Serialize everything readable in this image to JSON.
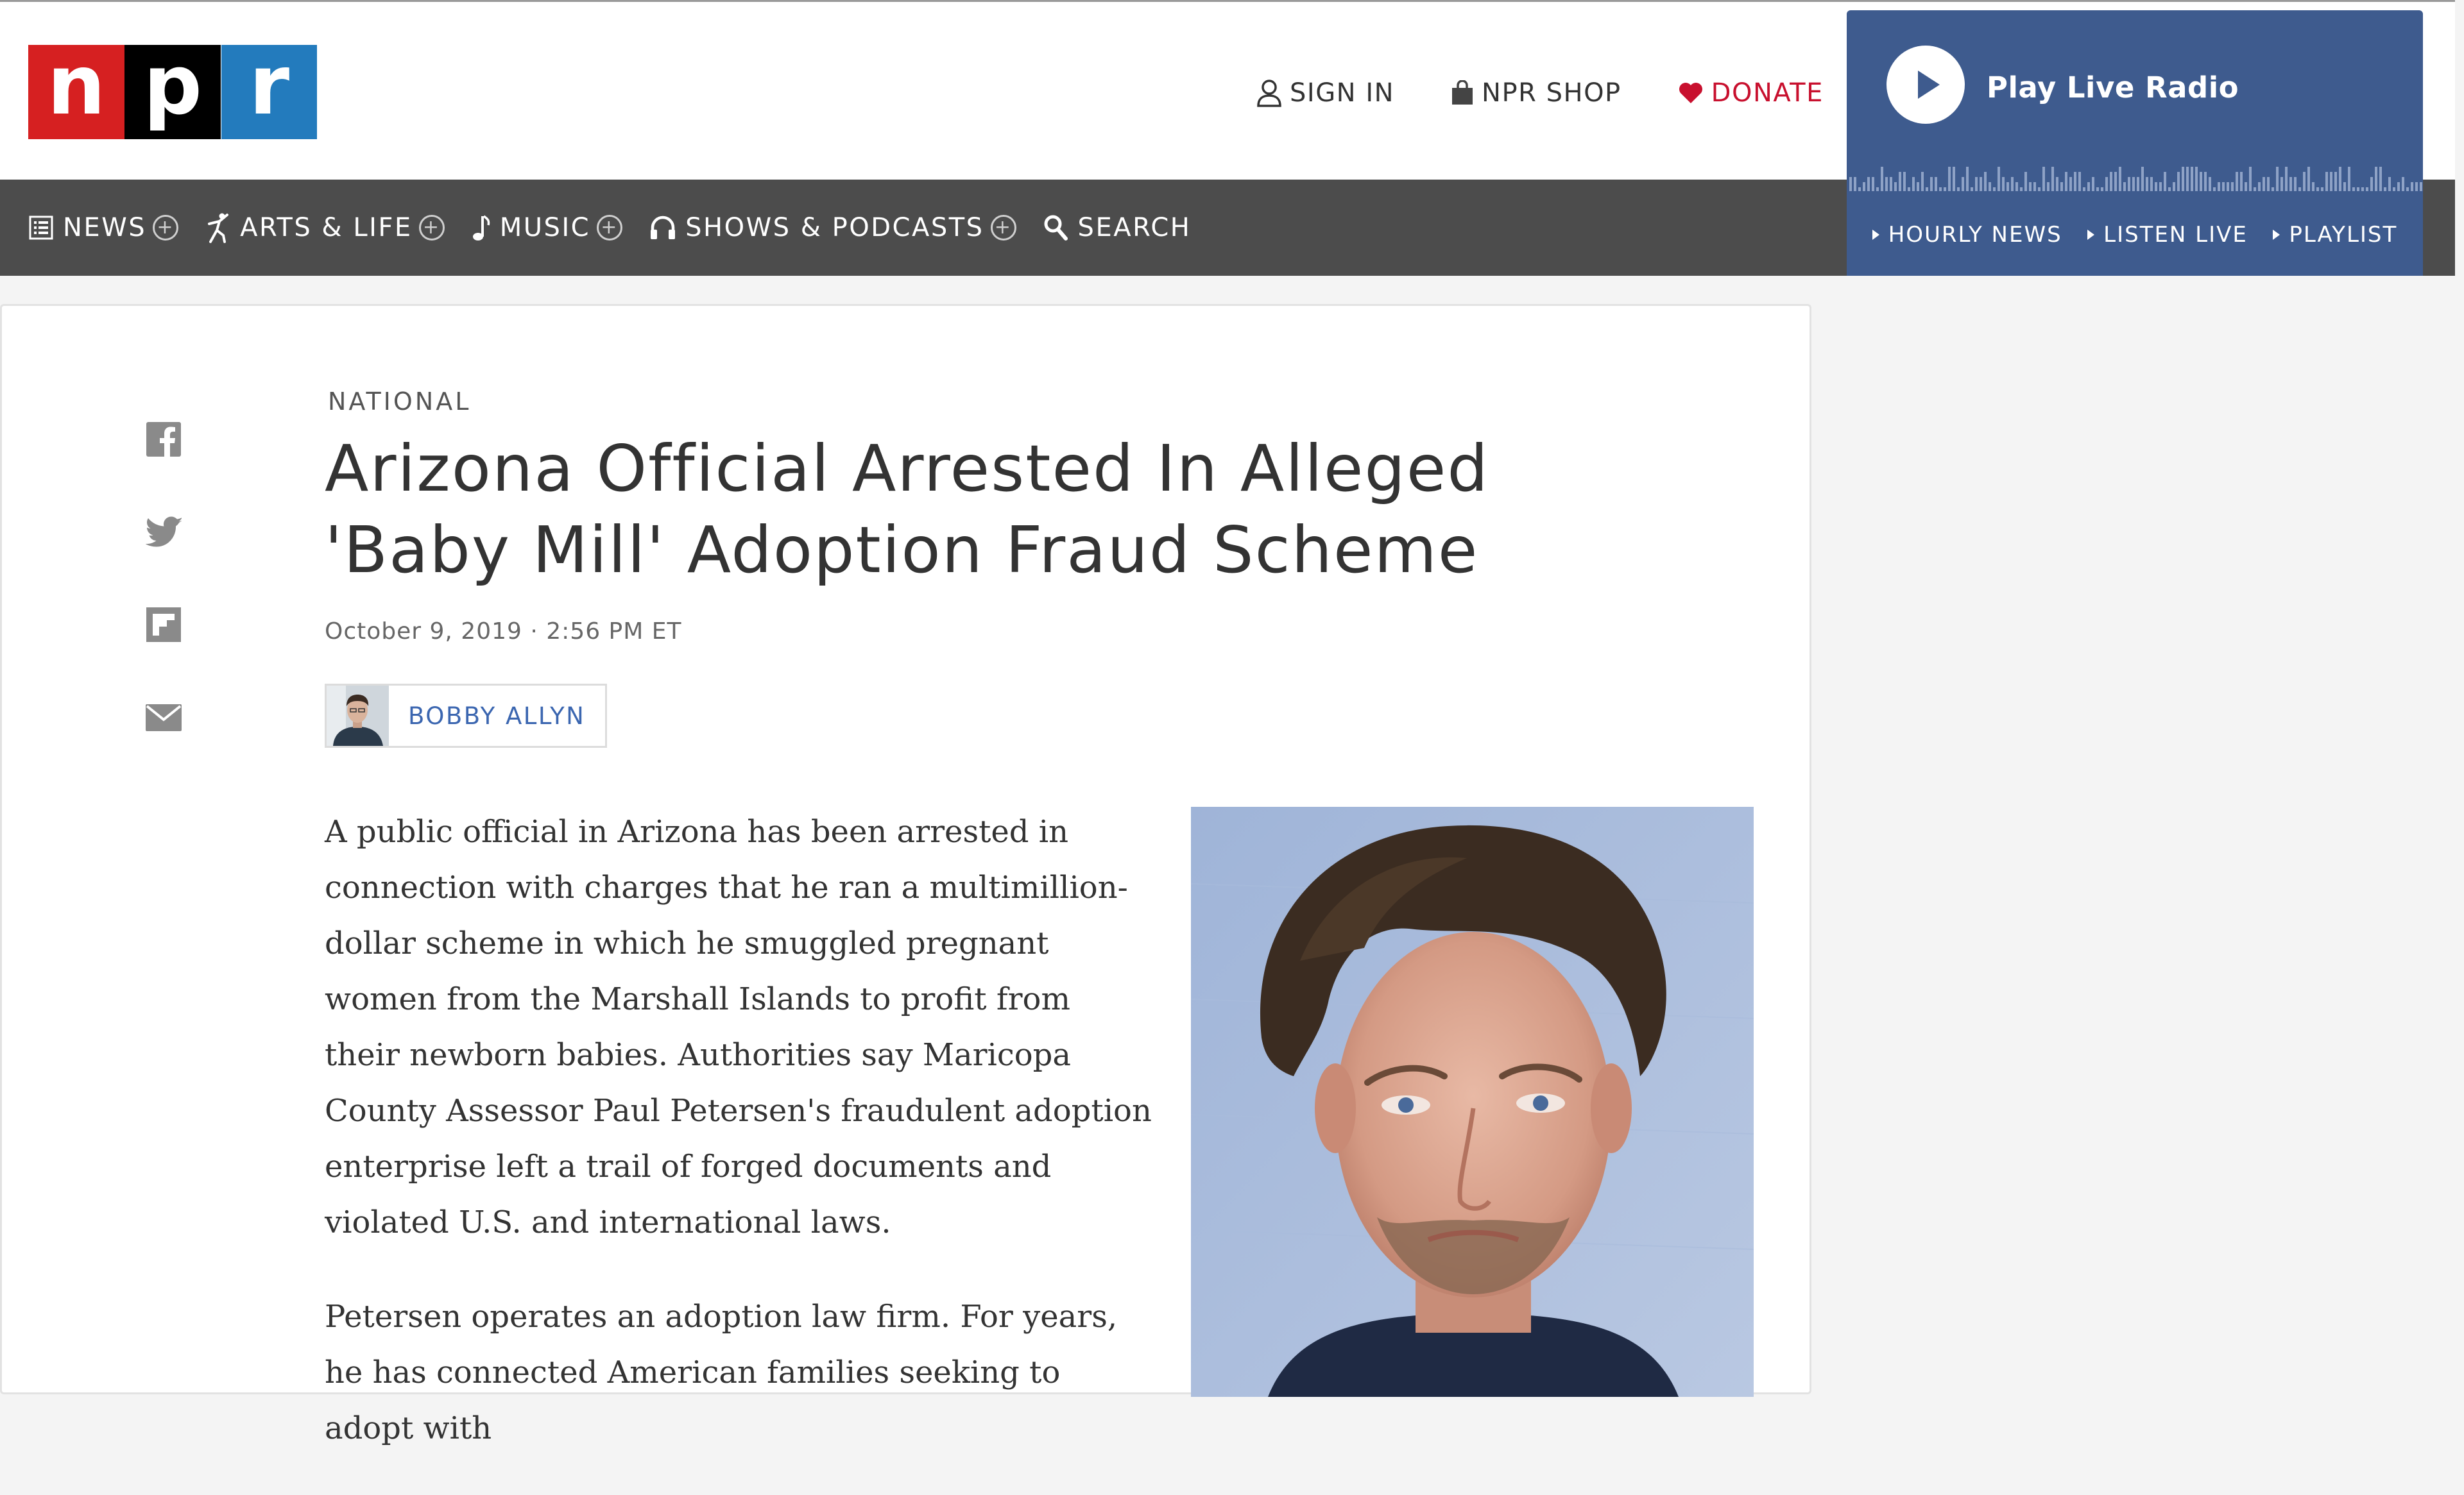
{
  "brand": {
    "logo_letters": [
      "n",
      "p",
      "r"
    ],
    "colors": {
      "red": "#d62021",
      "black": "#000000",
      "blue": "#237bbd"
    }
  },
  "utility_nav": {
    "sign_in": "SIGN IN",
    "shop": "NPR SHOP",
    "donate": "DONATE"
  },
  "radio": {
    "title": "Play Live Radio",
    "links": [
      "HOURLY NEWS",
      "LISTEN LIVE",
      "PLAYLIST"
    ],
    "color": "#3e5b8e"
  },
  "main_nav": {
    "items": [
      {
        "label": "NEWS",
        "icon": "list-icon",
        "expandable": true
      },
      {
        "label": "ARTS & LIFE",
        "icon": "dancer-icon",
        "expandable": true
      },
      {
        "label": "MUSIC",
        "icon": "music-note-icon",
        "expandable": true
      },
      {
        "label": "SHOWS & PODCASTS",
        "icon": "headphones-icon",
        "expandable": true
      },
      {
        "label": "SEARCH",
        "icon": "search-icon",
        "expandable": false
      }
    ]
  },
  "share": [
    "facebook-icon",
    "twitter-icon",
    "flipboard-icon",
    "email-icon"
  ],
  "article": {
    "section": "NATIONAL",
    "headline_line1": "Arizona Official Arrested In Alleged",
    "headline_line2": "'Baby Mill' Adoption Fraud Scheme",
    "date": "October 9, 2019 · 2:56 PM ET",
    "author": "BOBBY ALLYN",
    "paragraphs": [
      "A public official in Arizona has been arrested in connection with charges that he ran a multimillion-dollar scheme in which he smuggled pregnant women from the Marshall Islands to profit from their newborn babies. Authorities say Maricopa County Assessor Paul Petersen's fraudulent adoption enterprise left a trail of forged documents and violated U.S. and international laws.",
      "Petersen operates an adoption law firm. For years, he has connected American families seeking to adopt with"
    ]
  }
}
